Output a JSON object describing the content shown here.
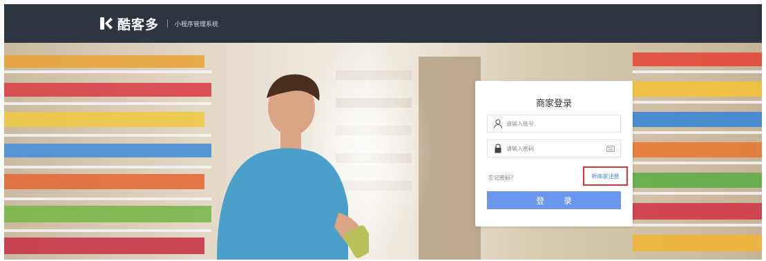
{
  "header": {
    "brand_name": "酷客多",
    "subtitle": "小程序管理系统"
  },
  "login": {
    "title": "商家登录",
    "account_placeholder": "请输入账号",
    "password_placeholder": "请输入密码",
    "forgot_password": "忘记密码?",
    "register": "新商家注册",
    "submit": "登 录"
  },
  "colors": {
    "header_bg": "#2d3541",
    "button_bg": "#6b96ee",
    "link": "#4a7fe0",
    "highlight_border": "#e0302a"
  },
  "icons": {
    "logo": "brand-k-icon",
    "account": "user-icon",
    "password": "lock-icon",
    "keyboard": "keyboard-icon"
  }
}
